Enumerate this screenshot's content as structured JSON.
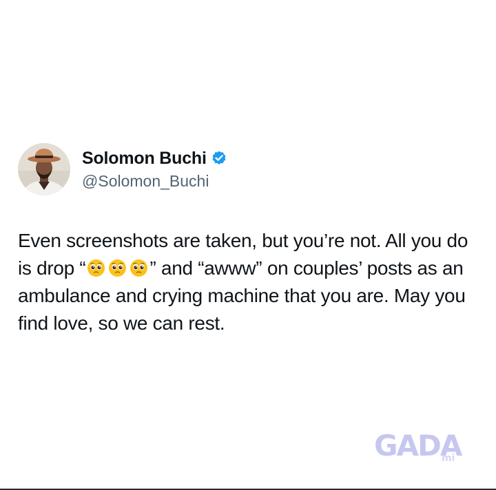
{
  "post": {
    "author": {
      "display_name": "Solomon Buchi",
      "handle": "@Solomon_Buchi",
      "verified": true
    },
    "text_parts": {
      "p1": "Even screenshots are taken, but you’re not. All you do is drop “",
      "p2": "” and “awww” on couples’ posts as an ambulance and crying machine that you are. May you find love, so we can rest."
    },
    "emojis": [
      "pleading-face",
      "pleading-face",
      "pleading-face"
    ]
  },
  "watermark": {
    "brand": "GADA",
    "suffix": "mi"
  },
  "colors": {
    "text": "#0f1419",
    "handle": "#536471",
    "verified_badge": "#1d9bf0",
    "watermark": "#c6c7f0"
  }
}
